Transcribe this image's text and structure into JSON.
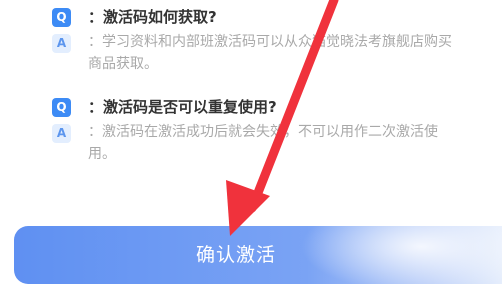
{
  "faq": [
    {
      "q_badge": "Q",
      "question": "：激活码如何获取?",
      "a_badge": "A",
      "answer": "：学习资料和内部班激活码可以从众猫觉晓法考旗舰店购买商品获取。"
    },
    {
      "q_badge": "Q",
      "question": "：激活码是否可以重复使用?",
      "a_badge": "A",
      "answer": "：激活码在激活成功后就会失效，不可以用作二次激活使用。"
    }
  ],
  "confirm_button": {
    "label": "确认激活",
    "color": "#5f90f2"
  },
  "annotation_arrow": {
    "color": "#f0323c"
  }
}
